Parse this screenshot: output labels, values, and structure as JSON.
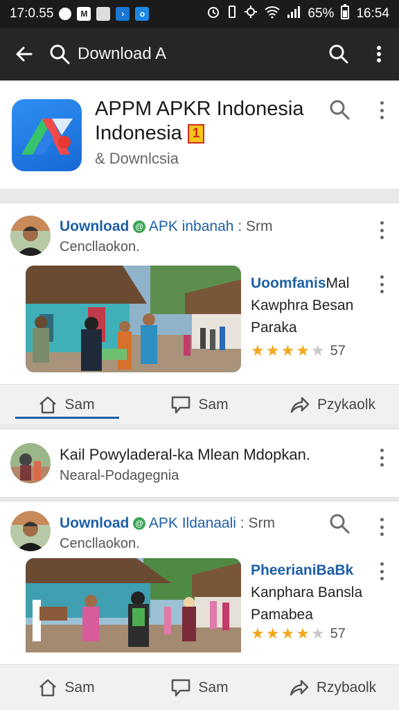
{
  "status_bar": {
    "left_time": "17:0.55",
    "battery": "65%",
    "time": "16:54"
  },
  "app_bar": {
    "query": "Download A"
  },
  "app_header": {
    "title_line1": "APPM APKR Indonesia",
    "title_line2": "Indonesia",
    "badge": "1",
    "subtitle": "& Downlcsia"
  },
  "feed": [
    {
      "title_bold": "Uownload",
      "title_rest": "APK inbanah",
      "title_sep": ":",
      "title_tail": "Srm",
      "subtitle": "Cencllaokon.",
      "post_title_bold": "Uoomfanis",
      "post_title_rest1": "Mal",
      "post_title_line2": "Kawphra Besan",
      "post_title_line3": "Paraka",
      "rating_count": "57",
      "actions": [
        "Sam",
        "Sam",
        "Pzykaolk"
      ]
    },
    {
      "title_bold": "Uownload",
      "title_rest": "APK Ildanaali",
      "title_sep": ":",
      "title_tail": "Srm",
      "subtitle": "Cencllaokon.",
      "post_title_bold": "PheerianiBaBk",
      "post_title_rest1": "",
      "post_title_line2": "Kanphara Bansla",
      "post_title_line3": "Pamabea",
      "rating_count": "57",
      "actions": [
        "Sam",
        "Sam",
        "Rzybaolk"
      ]
    }
  ],
  "single_post": {
    "title": "Kail Powyladeral-ka Mlean Mdopkan.",
    "subtitle": "Nearal-Podagegnia"
  },
  "colors": {
    "status_bar": "#1b1b1b",
    "app_bar": "#262626",
    "link_blue": "#1e5fa8",
    "star": "#f4a71d",
    "badge_yellow": "#f5c518",
    "badge_red": "#d22a1f"
  }
}
